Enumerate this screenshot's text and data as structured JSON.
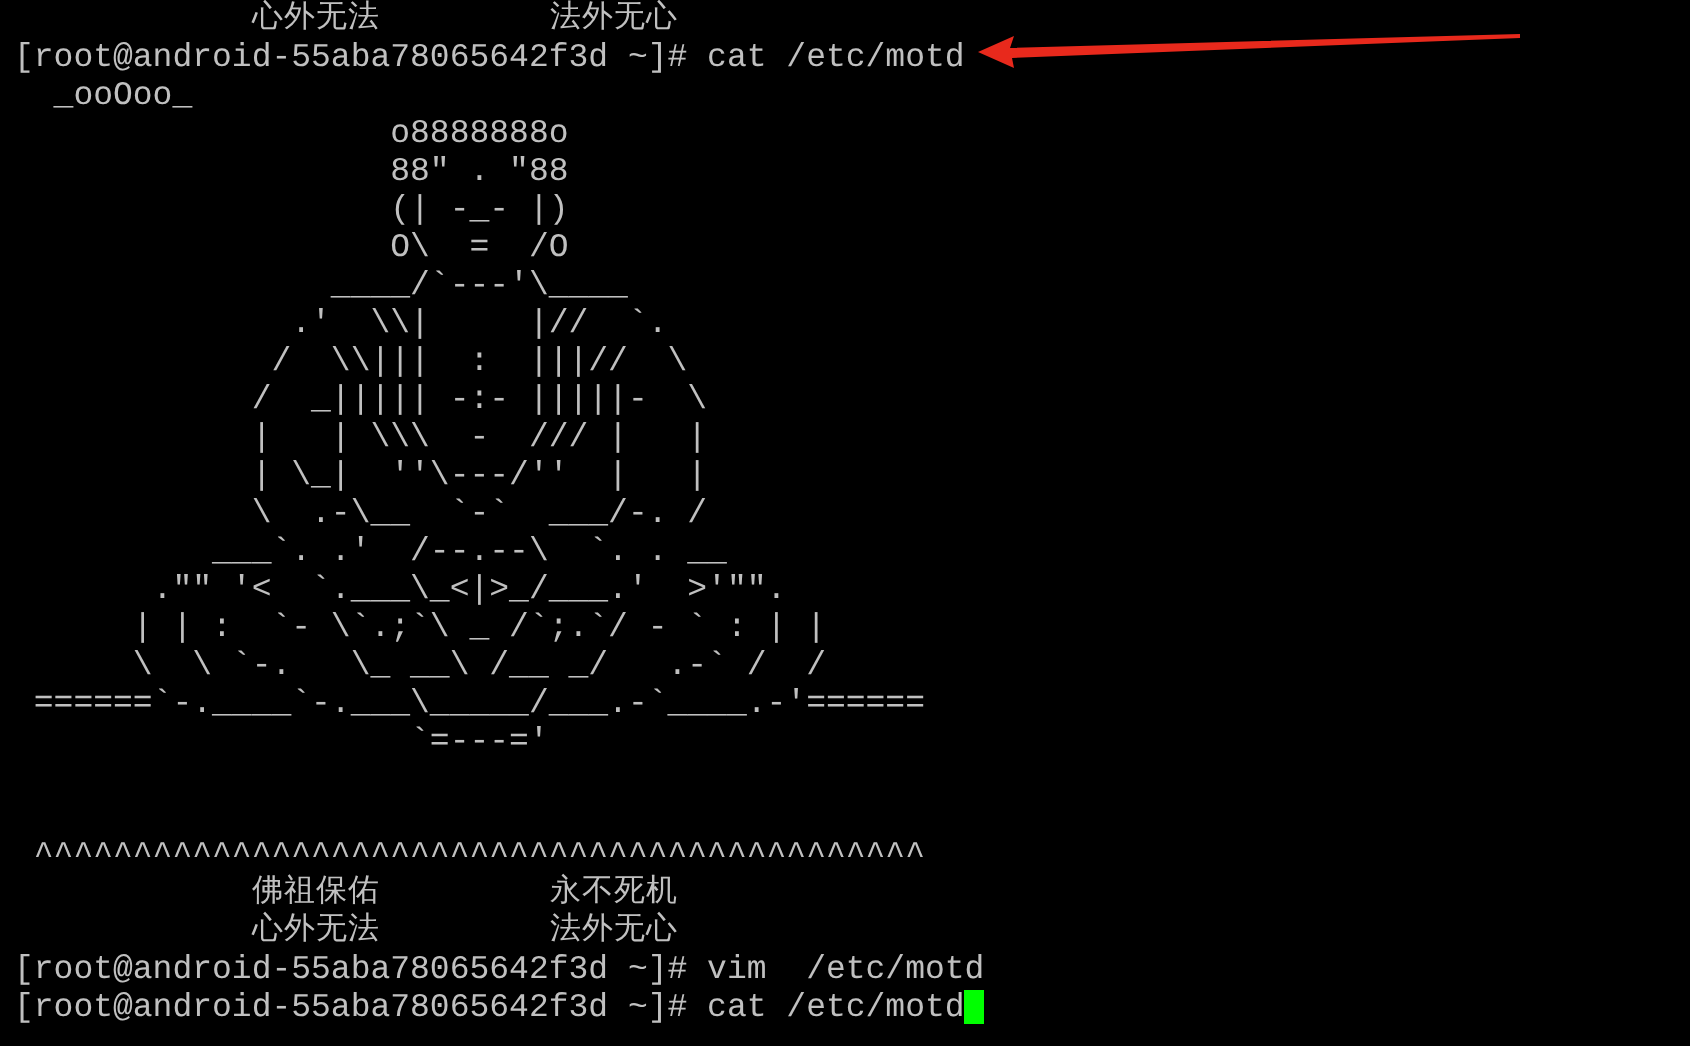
{
  "terminal": {
    "lines": [
      {
        "kind": "cjk",
        "left": "心外无法",
        "right": "法外无心"
      },
      {
        "kind": "text",
        "text": "[root@android-55aba78065642f3d ~]# cat /etc/motd",
        "cursor": false
      },
      {
        "kind": "art",
        "text": "  _ooOoo_"
      },
      {
        "kind": "art",
        "text": "                   o8888888o"
      },
      {
        "kind": "art",
        "text": "                   88\" . \"88"
      },
      {
        "kind": "art",
        "text": "                   (| -_- |)"
      },
      {
        "kind": "art",
        "text": "                   O\\  =  /O"
      },
      {
        "kind": "art",
        "text": "                ____/`---'\\____"
      },
      {
        "kind": "art",
        "text": "              .'  \\\\|     |//  `."
      },
      {
        "kind": "art",
        "text": "             /  \\\\|||  :  |||//  \\"
      },
      {
        "kind": "art",
        "text": "            /  _||||| -:- |||||-  \\"
      },
      {
        "kind": "art",
        "text": "            |   | \\\\\\  -  /// |   |"
      },
      {
        "kind": "art",
        "text": "            | \\_|  ''\\---/''  |   |"
      },
      {
        "kind": "art",
        "text": "            \\  .-\\__  `-`  ___/-. /"
      },
      {
        "kind": "art",
        "text": "          ___`. .'  /--.--\\  `. . __"
      },
      {
        "kind": "art",
        "text": "       .\"\" '<  `.___\\_<|>_/___.'  >'\"\"."
      },
      {
        "kind": "art",
        "text": "      | | :  `- \\`.;`\\ _ /`;.`/ - ` : | |"
      },
      {
        "kind": "art",
        "text": "      \\  \\ `-.   \\_ __\\ /__ _/   .-` /  /"
      },
      {
        "kind": "art",
        "text": " ======`-.____`-.___\\_____/___.-`____.-'======"
      },
      {
        "kind": "art",
        "text": "                    `=---='"
      },
      {
        "kind": "banner",
        "text": " ^^^^^^^^^^^^^^^^^^^^^^^^^^^^^^^^^^^^^^^^^^^^^"
      },
      {
        "kind": "cjk",
        "left": "佛祖保佑",
        "right": "永不死机"
      },
      {
        "kind": "cjk",
        "left": "心外无法",
        "right": "法外无心"
      },
      {
        "kind": "text",
        "text": "[root@android-55aba78065642f3d ~]# vim  /etc/motd",
        "cursor": false
      },
      {
        "kind": "text",
        "text": "[root@android-55aba78065642f3d ~]# cat /etc/motd",
        "cursor": true
      }
    ]
  }
}
